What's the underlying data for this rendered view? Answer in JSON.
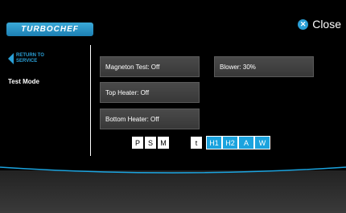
{
  "header": {
    "logo_text": "TURBOCHEF",
    "close_label": "Close"
  },
  "sidebar": {
    "back_label": "RETURN TO SERVICE",
    "current_item": "Test Mode"
  },
  "tests": {
    "magnetron": "Magneton Test: Off",
    "blower": "Blower: 30%",
    "top_heater": "Top Heater: Off",
    "bottom_heater": "Bottom Heater: Off"
  },
  "modes": {
    "group1": [
      "P",
      "S",
      "M"
    ],
    "group2": [
      "t"
    ],
    "group3": [
      "H1",
      "H2",
      "A",
      "W"
    ]
  },
  "colors": {
    "accent": "#2a9fd6",
    "mode_active": "#1ba3de"
  }
}
